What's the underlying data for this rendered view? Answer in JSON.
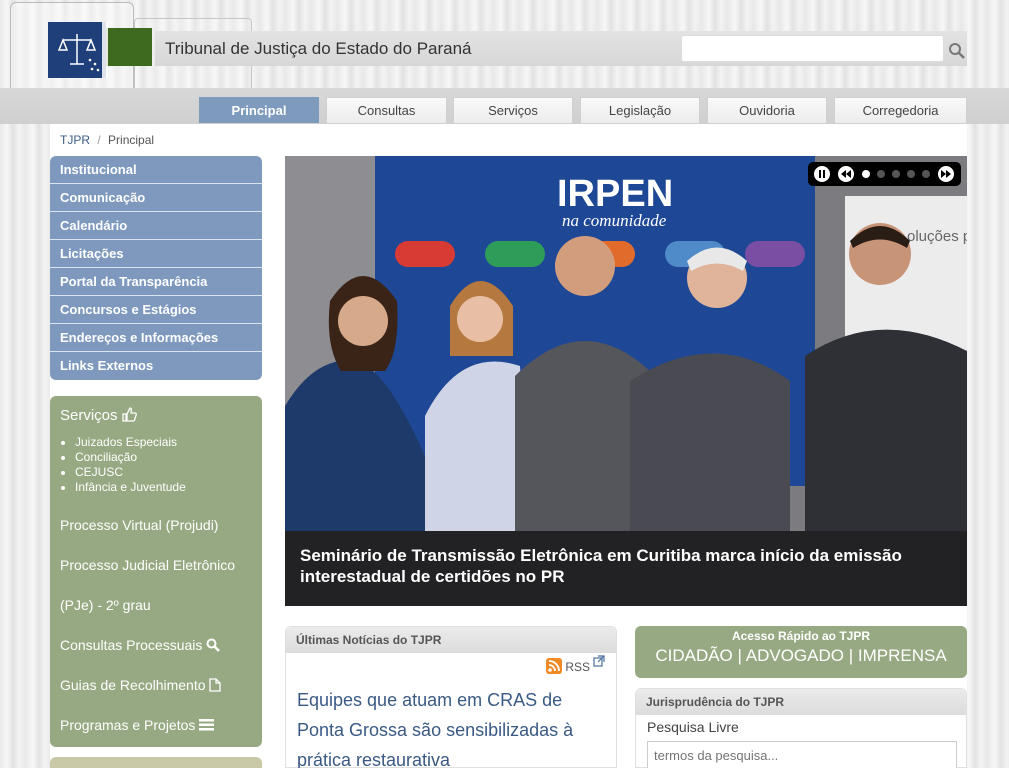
{
  "header": {
    "site_title": "Tribunal de Justiça do Estado do Paraná",
    "search_placeholder": ""
  },
  "nav": {
    "tabs": [
      {
        "label": "Principal",
        "active": true
      },
      {
        "label": "Consultas"
      },
      {
        "label": "Serviços"
      },
      {
        "label": "Legislação"
      },
      {
        "label": "Ouvidoria"
      },
      {
        "label": "Corregedoria"
      }
    ]
  },
  "breadcrumb": {
    "root": "TJPR",
    "separator": "/",
    "current": "Principal"
  },
  "sidebar": {
    "menu": [
      {
        "label": "Institucional"
      },
      {
        "label": "Comunicação"
      },
      {
        "label": "Calendário"
      },
      {
        "label": "Licitações"
      },
      {
        "label": "Portal da Transparência"
      },
      {
        "label": "Concursos e Estágios"
      },
      {
        "label": "Endereços e Informações"
      },
      {
        "label": "Links Externos"
      }
    ],
    "services": {
      "title": "Serviços",
      "title_icon": "thumbs-up-icon",
      "sub_items": [
        {
          "label": "Juizados Especiais"
        },
        {
          "label": "Conciliação"
        },
        {
          "label": "CEJUSC"
        },
        {
          "label": "Infância e Juventude"
        }
      ],
      "links": [
        {
          "label": "Processo Virtual (Projudi)",
          "icon": ""
        },
        {
          "label": "Processo Judicial Eletrônico",
          "icon": ""
        },
        {
          "label": "(PJe) - 2º grau",
          "icon": ""
        },
        {
          "label": "Consultas Processuais",
          "icon": "search-icon"
        },
        {
          "label": "Guias de Recolhimento",
          "icon": "document-icon"
        },
        {
          "label": "Programas e Projetos",
          "icon": "list-icon"
        }
      ]
    }
  },
  "slider": {
    "caption": "Seminário de Transmissão Eletrônica em Curitiba marca início da emissão interestadual de certidões no PR",
    "banner_title": "IRPEN",
    "banner_subtitle": "na comunidade",
    "side_banner_text": "oluções para as",
    "slide_count": 5,
    "active_slide": 0
  },
  "news": {
    "header": "Últimas Notícias do TJPR",
    "rss_label": "RSS",
    "headline": "Equipes que atuam em CRAS de Ponta Grossa são sensibilizadas à prática restaurativa"
  },
  "quick_access": {
    "title": "Acesso Rápido ao TJPR",
    "links": [
      "CIDADÃO",
      "ADVOGADO",
      "IMPRENSA"
    ],
    "separator": " | "
  },
  "jurisprudence": {
    "header": "Jurisprudência do TJPR",
    "label": "Pesquisa Livre",
    "placeholder": "termos da pesquisa..."
  },
  "colors": {
    "menu_blue": "#7e99bd",
    "services_green": "#97a982",
    "link_blue": "#3a5a84"
  }
}
